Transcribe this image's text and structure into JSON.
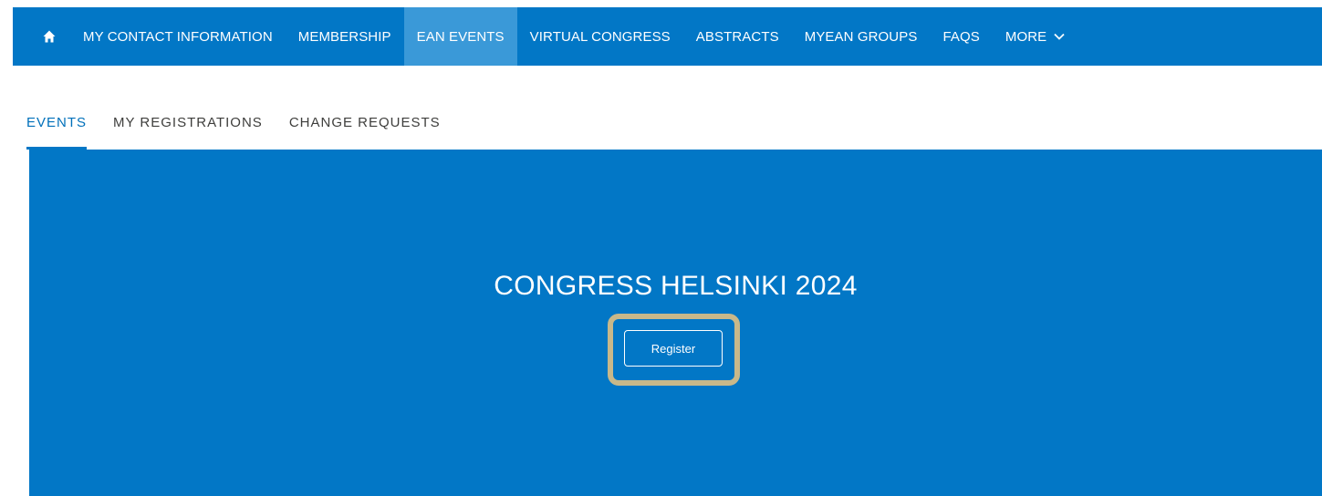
{
  "topnav": {
    "home_icon": "home-icon",
    "items": [
      {
        "label": "MY CONTACT INFORMATION",
        "active": false
      },
      {
        "label": "MEMBERSHIP",
        "active": false
      },
      {
        "label": "EAN EVENTS",
        "active": true
      },
      {
        "label": "VIRTUAL CONGRESS",
        "active": false
      },
      {
        "label": "ABSTRACTS",
        "active": false
      },
      {
        "label": "MYEAN GROUPS",
        "active": false
      },
      {
        "label": "FAQS",
        "active": false
      }
    ],
    "more_label": "MORE",
    "more_icon": "chevron-down-icon"
  },
  "subtabs": {
    "items": [
      {
        "label": "EVENTS",
        "active": true
      },
      {
        "label": "MY REGISTRATIONS",
        "active": false
      },
      {
        "label": "CHANGE REQUESTS",
        "active": false
      }
    ]
  },
  "hero": {
    "title": "CONGRESS HELSINKI 2024",
    "register_label": "Register"
  },
  "colors": {
    "brand_blue": "#0277c6",
    "active_nav": "#3a99d8",
    "highlight": "#c8b88a"
  }
}
